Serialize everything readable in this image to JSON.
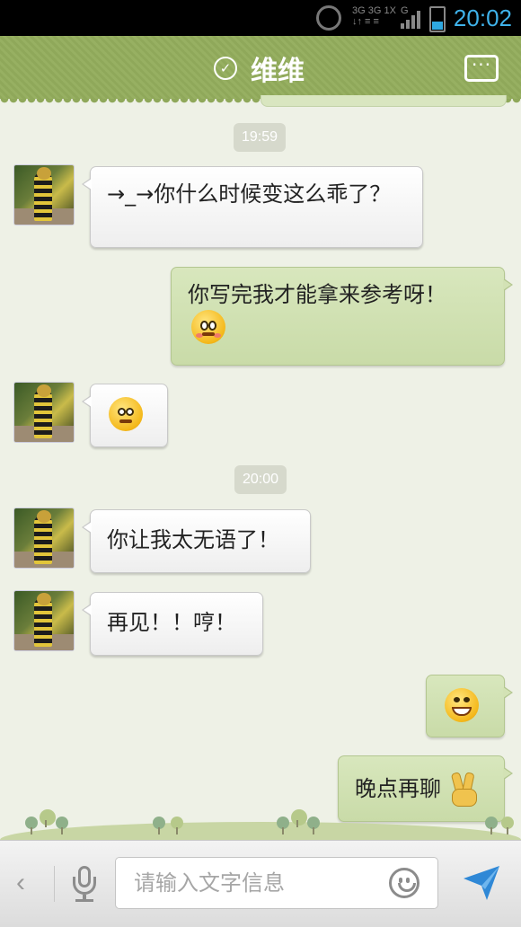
{
  "status_bar": {
    "time": "20:02",
    "network_top": "3G 3G 1X",
    "network_bottom": "↓↑ ≡ ≡",
    "network_g": "G"
  },
  "header": {
    "title": "维维",
    "more_label": "···"
  },
  "messages": [
    {
      "kind": "timestamp",
      "text": "19:59"
    },
    {
      "kind": "incoming",
      "text": "→_→你什么时候变这么乖了？"
    },
    {
      "kind": "outgoing",
      "text": "你写完我才能拿来参考呀！",
      "emoticon": "shy-face"
    },
    {
      "kind": "incoming",
      "text": "",
      "emoticon": "doubt-face"
    },
    {
      "kind": "timestamp",
      "text": "20:00"
    },
    {
      "kind": "incoming",
      "text": "你让我太无语了！"
    },
    {
      "kind": "incoming",
      "text": "再见！！哼！"
    },
    {
      "kind": "outgoing",
      "text": "",
      "emoticon": "grin-face"
    },
    {
      "kind": "outgoing",
      "text": "晚点再聊",
      "emoticon": "victory-hand"
    }
  ],
  "input_bar": {
    "back_label": "‹",
    "placeholder": "请输入文字信息",
    "icons": [
      "mic-icon",
      "smiley-icon",
      "send-icon"
    ]
  },
  "colors": {
    "header_green": "#8fa85a",
    "outgoing_bubble": "#d3e2b5",
    "incoming_bubble": "#ffffff",
    "background": "#eef1e6",
    "send_blue": "#2f88d6",
    "status_time": "#3fb2ea"
  }
}
